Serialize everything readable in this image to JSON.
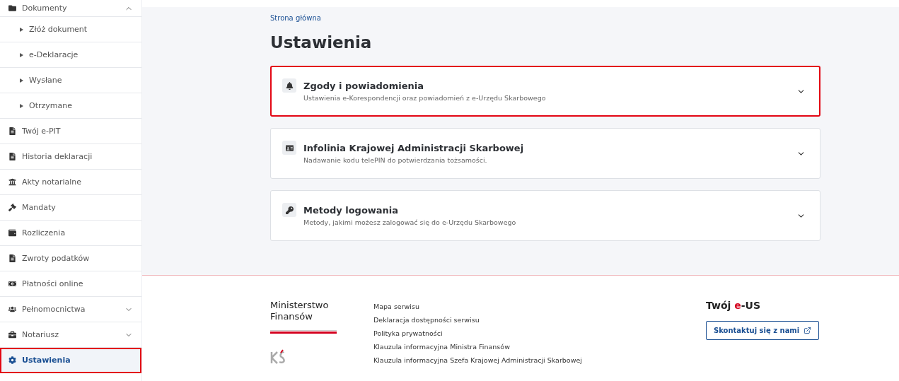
{
  "sidebar": {
    "items": [
      {
        "kind": "group",
        "label": "Dokumenty",
        "expanded": true,
        "selected": false,
        "highlighted": false
      },
      {
        "kind": "sub",
        "label": "Złóż dokument",
        "selected": false,
        "highlighted": false
      },
      {
        "kind": "sub",
        "label": "e-Deklaracje",
        "selected": false,
        "highlighted": false
      },
      {
        "kind": "sub",
        "label": "Wysłane",
        "selected": false,
        "highlighted": false
      },
      {
        "kind": "sub",
        "label": "Otrzymane",
        "selected": false,
        "highlighted": false
      },
      {
        "kind": "link",
        "label": "Twój e-PIT",
        "selected": false,
        "highlighted": false
      },
      {
        "kind": "link",
        "label": "Historia deklaracji",
        "selected": false,
        "highlighted": false
      },
      {
        "kind": "link",
        "label": "Akty notarialne",
        "selected": false,
        "highlighted": false
      },
      {
        "kind": "link",
        "label": "Mandaty",
        "selected": false,
        "highlighted": false
      },
      {
        "kind": "link",
        "label": "Rozliczenia",
        "selected": false,
        "highlighted": false
      },
      {
        "kind": "link",
        "label": "Zwroty podatków",
        "selected": false,
        "highlighted": false
      },
      {
        "kind": "link",
        "label": "Płatności online",
        "selected": false,
        "highlighted": false
      },
      {
        "kind": "group",
        "label": "Pełnomocnictwa",
        "expanded": false,
        "selected": false,
        "highlighted": false
      },
      {
        "kind": "group",
        "label": "Notariusz",
        "expanded": false,
        "selected": false,
        "highlighted": false
      },
      {
        "kind": "link",
        "label": "Ustawienia",
        "selected": true,
        "highlighted": true
      }
    ]
  },
  "breadcrumb": "Strona główna",
  "title": "Ustawienia",
  "sections": [
    {
      "title": "Zgody i powiadomienia",
      "description": "Ustawienia e-Korespondencji oraz powiadomień z e-Urzędu Skarbowego",
      "expanded": false,
      "highlighted": true
    },
    {
      "title": "Infolinia Krajowej Administracji Skarbowej",
      "description": "Nadawanie kodu telePIN do potwierdzania tożsamości.",
      "expanded": false,
      "highlighted": false
    },
    {
      "title": "Metody logowania",
      "description": "Metody, jakimi możesz zalogować się do e-Urzędu Skarbowego",
      "expanded": false,
      "highlighted": false
    }
  ],
  "footer": {
    "ministry": [
      "Ministerstwo",
      "Finansów"
    ],
    "links": [
      "Mapa serwisu",
      "Deklaracja dostępności serwisu",
      "Polityka prywatności",
      "Klauzula informacyjna Ministra Finansów",
      "Klauzula informacyjna Szefa Krajowej Administracji Skarbowej"
    ],
    "brand": {
      "before": "Twój ",
      "accent": "e",
      "after": "-US"
    },
    "contact_button": "Skontaktuj się z nami"
  }
}
